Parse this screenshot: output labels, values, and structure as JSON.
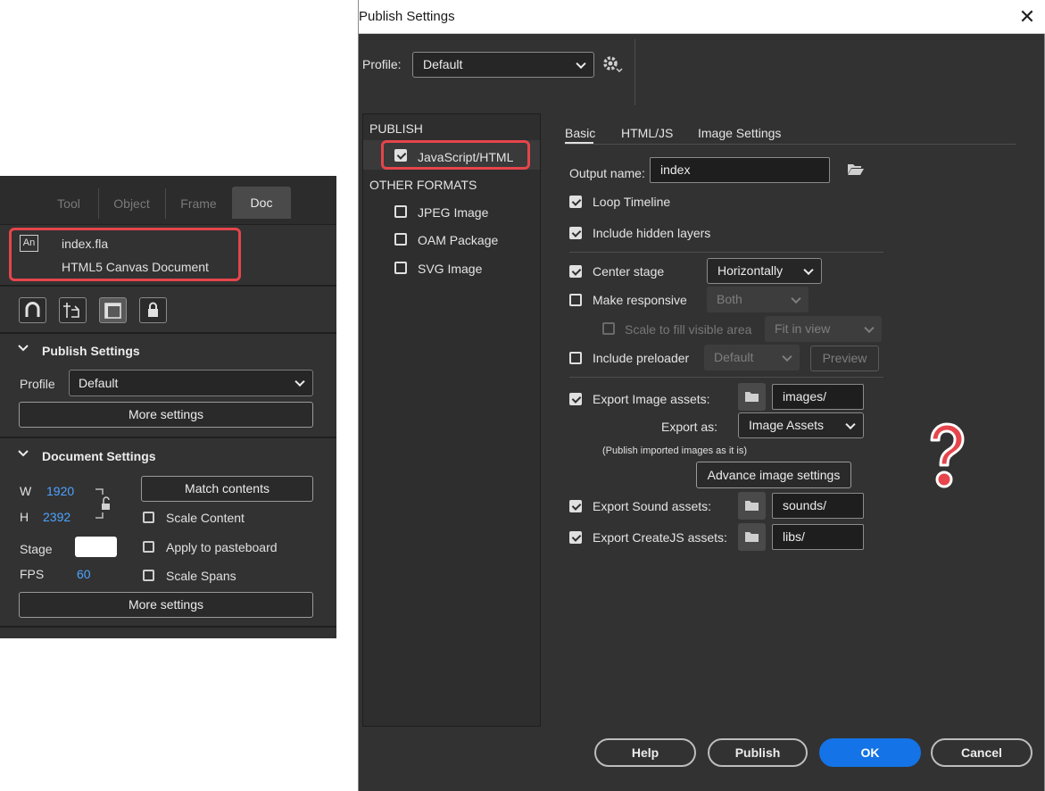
{
  "properties_panel": {
    "tabs": [
      "Tool",
      "Object",
      "Frame",
      "Doc"
    ],
    "active_tab": "Doc",
    "doc_icon": "An",
    "file_name": "index.fla",
    "doc_type": "HTML5 Canvas Document",
    "publish_settings": {
      "title": "Publish Settings",
      "profile_label": "Profile",
      "profile_value": "Default",
      "more_settings": "More settings"
    },
    "document_settings": {
      "title": "Document Settings",
      "w_label": "W",
      "w_value": "1920",
      "h_label": "H",
      "h_value": "2392",
      "match_contents": "Match contents",
      "scale_content": "Scale Content",
      "stage_label": "Stage",
      "apply_to_pasteboard": "Apply to pasteboard",
      "fps_label": "FPS",
      "fps_value": "60",
      "scale_spans": "Scale Spans",
      "more_settings": "More settings"
    }
  },
  "dialog": {
    "title": "Publish Settings",
    "profile_label": "Profile:",
    "profile_value": "Default",
    "left": {
      "publish_header": "PUBLISH",
      "javascript_html": "JavaScript/HTML",
      "other_formats_header": "OTHER FORMATS",
      "formats": [
        "JPEG Image",
        "OAM Package",
        "SVG Image"
      ]
    },
    "tabs": [
      "Basic",
      "HTML/JS",
      "Image Settings"
    ],
    "active_tab": "Basic",
    "output_name_label": "Output name:",
    "output_name_value": "index",
    "loop_timeline": "Loop Timeline",
    "include_hidden_layers": "Include hidden layers",
    "center_stage": "Center stage",
    "center_stage_value": "Horizontally",
    "make_responsive": "Make responsive",
    "make_responsive_value": "Both",
    "scale_to_fill": "Scale to fill visible area",
    "scale_to_fill_value": "Fit in view",
    "include_preloader": "Include preloader",
    "preloader_value": "Default",
    "preview": "Preview",
    "export_image_assets": "Export Image assets:",
    "images_path": "images/",
    "export_as_label": "Export as:",
    "export_as_value": "Image Assets",
    "publish_note": "(Publish imported images as it is)",
    "advance_image_settings": "Advance image settings",
    "export_sound_assets": "Export Sound assets:",
    "sounds_path": "sounds/",
    "export_createjs_assets": "Export CreateJS assets:",
    "libs_path": "libs/",
    "buttons": {
      "help": "Help",
      "publish": "Publish",
      "ok": "OK",
      "cancel": "Cancel"
    }
  },
  "annotation": {
    "icon": "question-mark-icon",
    "color": "#e5454b"
  }
}
